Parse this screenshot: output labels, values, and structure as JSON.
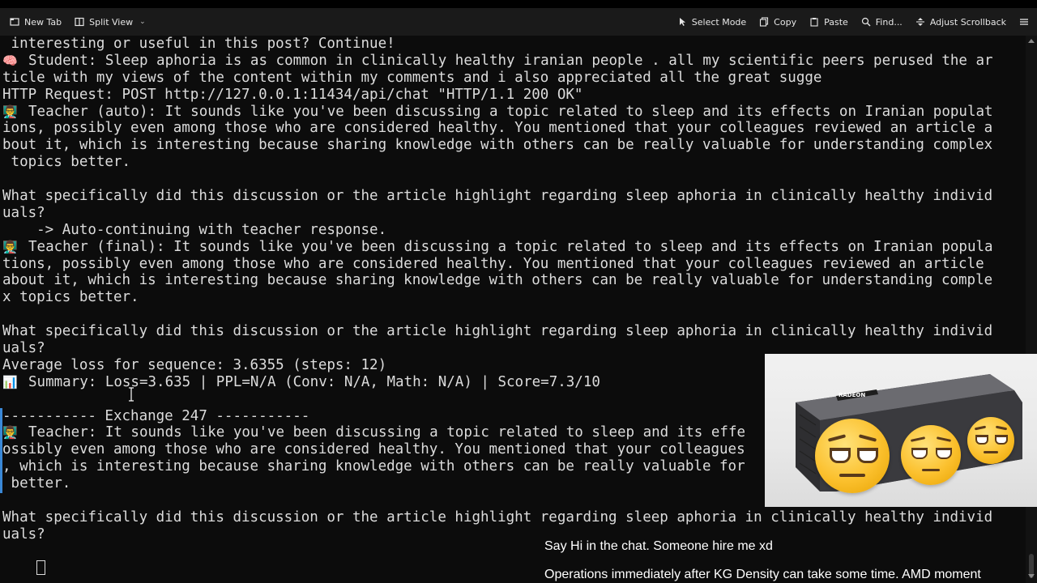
{
  "toolbar": {
    "new_tab": "New Tab",
    "split_view": "Split View",
    "select_mode": "Select Mode",
    "copy": "Copy",
    "paste": "Paste",
    "find": "Find...",
    "adjust_scrollback": "Adjust Scrollback"
  },
  "terminal": {
    "lines": [
      {
        "text": " interesting or useful in this post? Continue!"
      },
      {
        "glyph": "🧠",
        "text": "Student: Sleep aphoria is as common in clinically healthy iranian people . all my scientific peers perused the ar"
      },
      {
        "text": "ticle with my views of the content within my comments and i also appreciated all the great sugge"
      },
      {
        "text": "HTTP Request: POST http://127.0.0.1:11434/api/chat \"HTTP/1.1 200 OK\""
      },
      {
        "glyph": "👨‍🏫",
        "text": "Teacher (auto): It sounds like you've been discussing a topic related to sleep and its effects on Iranian populat"
      },
      {
        "text": "ions, possibly even among those who are considered healthy. You mentioned that your colleagues reviewed an article a"
      },
      {
        "text": "bout it, which is interesting because sharing knowledge with others can be really valuable for understanding complex"
      },
      {
        "text": " topics better."
      },
      {
        "text": ""
      },
      {
        "text": "What specifically did this discussion or the article highlight regarding sleep aphoria in clinically healthy individ"
      },
      {
        "text": "uals?"
      },
      {
        "text": "    -> Auto-continuing with teacher response."
      },
      {
        "glyph": "👨‍🏫",
        "text": "Teacher (final): It sounds like you've been discussing a topic related to sleep and its effects on Iranian popula"
      },
      {
        "text": "tions, possibly even among those who are considered healthy. You mentioned that your colleagues reviewed an article"
      },
      {
        "text": "about it, which is interesting because sharing knowledge with others can be really valuable for understanding comple"
      },
      {
        "text": "x topics better."
      },
      {
        "text": ""
      },
      {
        "text": "What specifically did this discussion or the article highlight regarding sleep aphoria in clinically healthy individ"
      },
      {
        "text": "uals?"
      },
      {
        "text": "Average loss for sequence: 3.6355 (steps: 12)"
      },
      {
        "glyph": "📊",
        "text": "Summary: Loss=3.635 | PPL=N/A (Conv: N/A, Math: N/A) | Score=7.3/10"
      },
      {
        "text": ""
      },
      {
        "text": "----------- Exchange 247 -----------"
      },
      {
        "glyph": "👨‍🏫",
        "text": "Teacher: It sounds like you've been discussing a topic related to sleep and its effe"
      },
      {
        "text": "ossibly even among those who are considered healthy. You mentioned that your colleagues"
      },
      {
        "text": ", which is interesting because sharing knowledge with others can be really valuable for"
      },
      {
        "text": " better."
      },
      {
        "text": ""
      },
      {
        "text": "What specifically did this discussion or the article highlight regarding sleep aphoria in clinically healthy individ"
      },
      {
        "text": "uals?"
      }
    ]
  },
  "overlay": {
    "gpu_brand": "RADEON",
    "caption_1": "Say Hi in the chat. Someone hire me xd",
    "caption_2": "Operations immediately after KG Density can take some time. AMD moment"
  }
}
